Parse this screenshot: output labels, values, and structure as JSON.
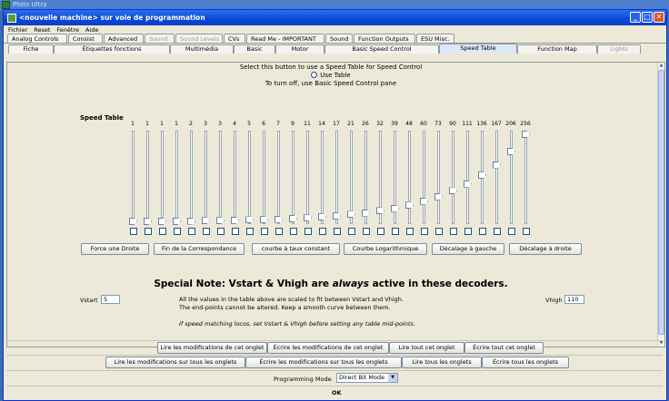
{
  "bg_window": {
    "title": "Ptoto Ultra"
  },
  "window": {
    "title": "<nouvelle machine> sur voie de programmation",
    "min": "_",
    "max": "□",
    "close": "✕"
  },
  "menu": [
    "Fichier",
    "Reset",
    "Fenêtre",
    "Aide"
  ],
  "tabs_row1": [
    {
      "label": "Analog Controls",
      "w": 66,
      "state": "normal"
    },
    {
      "label": "Consist",
      "w": 38,
      "state": "normal"
    },
    {
      "label": "Advanced",
      "w": 44,
      "state": "normal"
    },
    {
      "label": "Sound",
      "w": 33,
      "state": "disabled"
    },
    {
      "label": "Sound Levels",
      "w": 52,
      "state": "disabled"
    },
    {
      "label": "CVs",
      "w": 24,
      "state": "normal"
    },
    {
      "label": "Read Me - IMPORTANT",
      "w": 86,
      "state": "normal"
    },
    {
      "label": "Sound",
      "w": 30,
      "state": "normal"
    },
    {
      "label": "Function Outputs",
      "w": 68,
      "state": "normal"
    },
    {
      "label": "ESU Misc.",
      "w": 42,
      "state": "normal"
    }
  ],
  "tabs_row2": [
    {
      "label": "Fiche",
      "w": 50,
      "state": "normal"
    },
    {
      "label": "Étiquettes fonctions",
      "w": 128,
      "state": "normal"
    },
    {
      "label": "Multimédia",
      "w": 70,
      "state": "normal"
    },
    {
      "label": "Basic",
      "w": 46,
      "state": "normal"
    },
    {
      "label": "Motor",
      "w": 54,
      "state": "normal"
    },
    {
      "label": "Basic Speed Control",
      "w": 126,
      "state": "normal"
    },
    {
      "label": "Speed Table",
      "w": 86,
      "state": "selected"
    },
    {
      "label": "Function Map",
      "w": 88,
      "state": "normal"
    },
    {
      "label": "Lights",
      "w": 48,
      "state": "disabled"
    }
  ],
  "panel": {
    "instruction": "Select this button to use a Speed Table for Speed Control",
    "radio_label": "Use Table",
    "turn_off": "To turn off, use Basic Speed Control pane",
    "speed_table_label": "Speed Table",
    "speed_table": {
      "values": [
        "1",
        "1",
        "1",
        "1",
        "2",
        "3",
        "3",
        "4",
        "5",
        "6",
        "7",
        "9",
        "11",
        "14",
        "17",
        "21",
        "26",
        "32",
        "39",
        "48",
        "60",
        "73",
        "90",
        "111",
        "136",
        "167",
        "206",
        "256"
      ],
      "levels": [
        1,
        1,
        1,
        1,
        2,
        3,
        3,
        4,
        5,
        6,
        7,
        9,
        11,
        14,
        17,
        21,
        26,
        32,
        39,
        48,
        60,
        73,
        90,
        111,
        136,
        167,
        206,
        256
      ]
    },
    "buttons": [
      "Force une Droite",
      "Fin de la Correspondance",
      "courbe à taux constant",
      "Courbe Logarithmique",
      "Décalage à gauche",
      "Décalage à droite"
    ],
    "note_prefix": "Special Note: Vstart & Vhigh are ",
    "note_emph": "always",
    "note_suffix": " active in these decoders.",
    "vstart_label": "Vstart",
    "vstart_value": "5",
    "vhigh_label": "Vhigh",
    "vhigh_value": "110",
    "info1": "All the values in the table above are scaled to fit between Vstart and Vhigh.",
    "info2": "The end-points cannot be altered. Keep a smooth curve between them.",
    "info3": "If speed matching locos, set Vstart & Vhigh before setting any table mid-points."
  },
  "bottom": {
    "row1": [
      "Lire les modifications de cet onglet",
      "Écrire les modifications de cet onglet",
      "Lire tout cet onglet",
      "Écrire tout cet onglet"
    ],
    "row2": [
      "Lire les modifications sur tous les onglets",
      "Écrire les modifications sur tous les onglets",
      "Lire tous les onglets",
      "Écrire tous les onglets"
    ],
    "prog_mode_label": "Programming Mode",
    "prog_mode_value": "Direct Bit Mode",
    "ok": "OK"
  }
}
